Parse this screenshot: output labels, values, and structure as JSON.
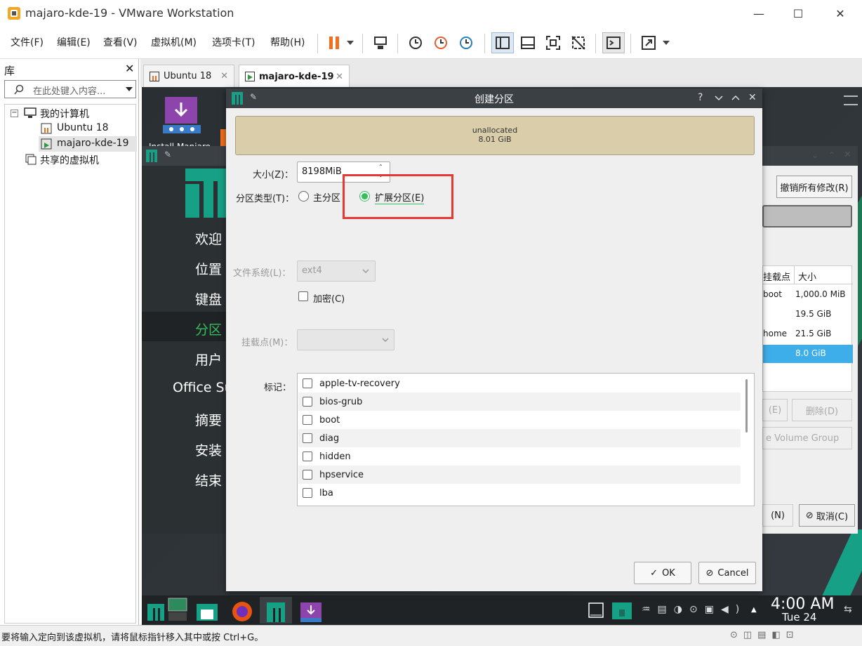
{
  "window": {
    "title": "majaro-kde-19 - VMware Workstation"
  },
  "menu": [
    "文件(F)",
    "编辑(E)",
    "查看(V)",
    "虚拟机(M)",
    "选项卡(T)",
    "帮助(H)"
  ],
  "library": {
    "title": "库",
    "search_placeholder": "在此处键入内容...",
    "tree": {
      "root": "我的计算机",
      "vms": [
        "Ubuntu 18",
        "majaro-kde-19"
      ],
      "shared": "共享的虚拟机"
    }
  },
  "tabs": [
    {
      "label": "Ubuntu 18"
    },
    {
      "label": "majaro-kde-19"
    }
  ],
  "installer": {
    "desktop_icon_label": "Install Manjaro",
    "nav": [
      "欢迎",
      "位置",
      "键盘",
      "分区",
      "用户",
      "Office Su",
      "摘要",
      "安装",
      "结束"
    ],
    "active_nav": "分区",
    "right": {
      "revert_button": "撤销所有修改(R)",
      "table_headers": [
        "挂载点",
        "大小"
      ],
      "rows": [
        {
          "mount": "boot",
          "size": "1,000.0 MiB"
        },
        {
          "mount": "",
          "size": "19.5 GiB"
        },
        {
          "mount": "home",
          "size": "21.5 GiB"
        },
        {
          "mount": "",
          "size": "8.0 GiB"
        }
      ],
      "edit_button": "(E)",
      "delete_button": "删除(D)",
      "lvm_button": "e Volume Group",
      "next_button": "(N)",
      "cancel_button": "取消(C)"
    }
  },
  "dialog": {
    "title": "创建分区",
    "bar": {
      "name": "unallocated",
      "size": "8.01 GiB"
    },
    "size_label": "大小(Z)：",
    "size_value": "8198MiB",
    "type_label": "分区类型(T)：",
    "primary_label": "主分区(P)",
    "extended_label": "扩展分区(E)",
    "fs_label": "文件系统(L)：",
    "fs_value": "ext4",
    "encrypt_label": "加密(C)",
    "mount_label": "挂载点(M)：",
    "flags_label": "标记：",
    "flags": [
      "apple-tv-recovery",
      "bios-grub",
      "boot",
      "diag",
      "hidden",
      "hpservice",
      "lba"
    ],
    "ok": "OK",
    "cancel": "Cancel"
  },
  "taskbar": {
    "time": "4:00 AM",
    "date": "Tue 24"
  },
  "statusbar": {
    "text": "要将输入定向到该虚拟机，请将鼠标指针移入其中或按 Ctrl+G。"
  },
  "colors": {
    "accent": "#35bf5c",
    "manjaro": "#16a085",
    "highlight": "#e53935",
    "selected_row": "#3daee9"
  }
}
